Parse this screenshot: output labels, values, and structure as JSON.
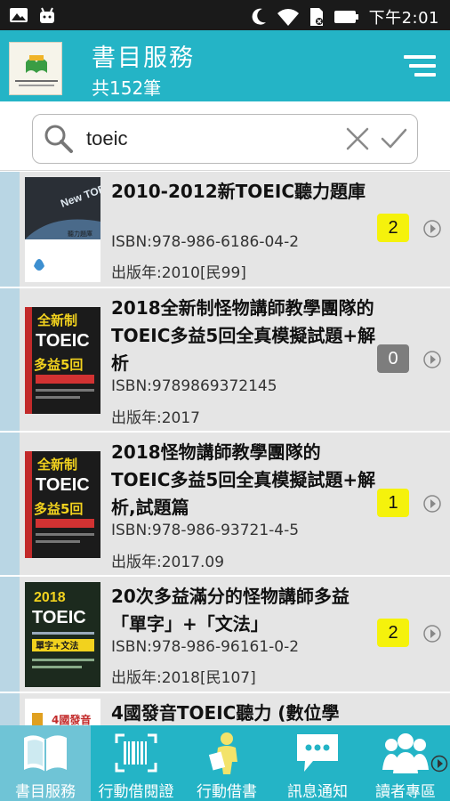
{
  "status_bar": {
    "time": "下午2:01",
    "icons": [
      "gallery-icon",
      "android-icon",
      "moon-icon",
      "wifi-icon",
      "sim-icon",
      "battery-icon"
    ]
  },
  "header": {
    "title": "書目服務",
    "subtitle": "共152筆",
    "logo_icon": "library-logo",
    "menu_icon": "menu-icon"
  },
  "search": {
    "value": "toeic",
    "placeholder": "",
    "clear_icon": "close-icon",
    "confirm_icon": "check-icon"
  },
  "books": [
    {
      "title": "2010-2012新TOEIC聽力題庫",
      "isbn": "ISBN:978-986-6186-04-2",
      "year": "出版年:2010[民99]",
      "count": "2",
      "badge_color": "#f5f20c",
      "cover_text": [
        "New TOEIC",
        "聽力題庫"
      ]
    },
    {
      "title": "2018全新制怪物講師教學團隊的TOEIC多益5回全真模擬試題+解析",
      "isbn": "ISBN:9789869372145",
      "year": "出版年:2017",
      "count": "0",
      "badge_color": "#7d7d7d",
      "cover_text": [
        "全新制",
        "TOEIC",
        "多益5回"
      ]
    },
    {
      "title": "2018怪物講師教學團隊的TOEIC多益5回全真模擬試題+解析,試題篇",
      "isbn": "ISBN:978-986-93721-4-5",
      "year": "出版年:2017.09",
      "count": "1",
      "badge_color": "#f5f20c",
      "cover_text": [
        "全新制",
        "TOEIC",
        "多益5回"
      ]
    },
    {
      "title": "20次多益滿分的怪物講師多益「單字」+「文法」",
      "isbn": "ISBN:978-986-96161-0-2",
      "year": "出版年:2018[民107]",
      "count": "2",
      "badge_color": "#f5f20c",
      "cover_text": [
        "2018",
        "TOEIC",
        "單字+文法"
      ]
    },
    {
      "title": "4國發音TOEIC聽力 (數位學",
      "isbn": "",
      "year": "",
      "count": "",
      "badge_color": "",
      "cover_text": [
        "4國發音"
      ]
    }
  ],
  "bottom_nav": [
    {
      "label": "書目服務",
      "icon": "book-icon",
      "active": true
    },
    {
      "label": "行動借閱證",
      "icon": "barcode-icon",
      "active": false
    },
    {
      "label": "行動借書",
      "icon": "person-book-icon",
      "active": false
    },
    {
      "label": "訊息通知",
      "icon": "chat-bubble-icon",
      "active": false
    },
    {
      "label": "讀者專區",
      "icon": "people-icon",
      "active": false
    }
  ],
  "colors": {
    "primary": "#24b4c6",
    "row_bg": "#e5e5e5",
    "stripe": "#b9d6e4",
    "badge_yellow": "#f5f20c",
    "badge_gray": "#7d7d7d"
  }
}
